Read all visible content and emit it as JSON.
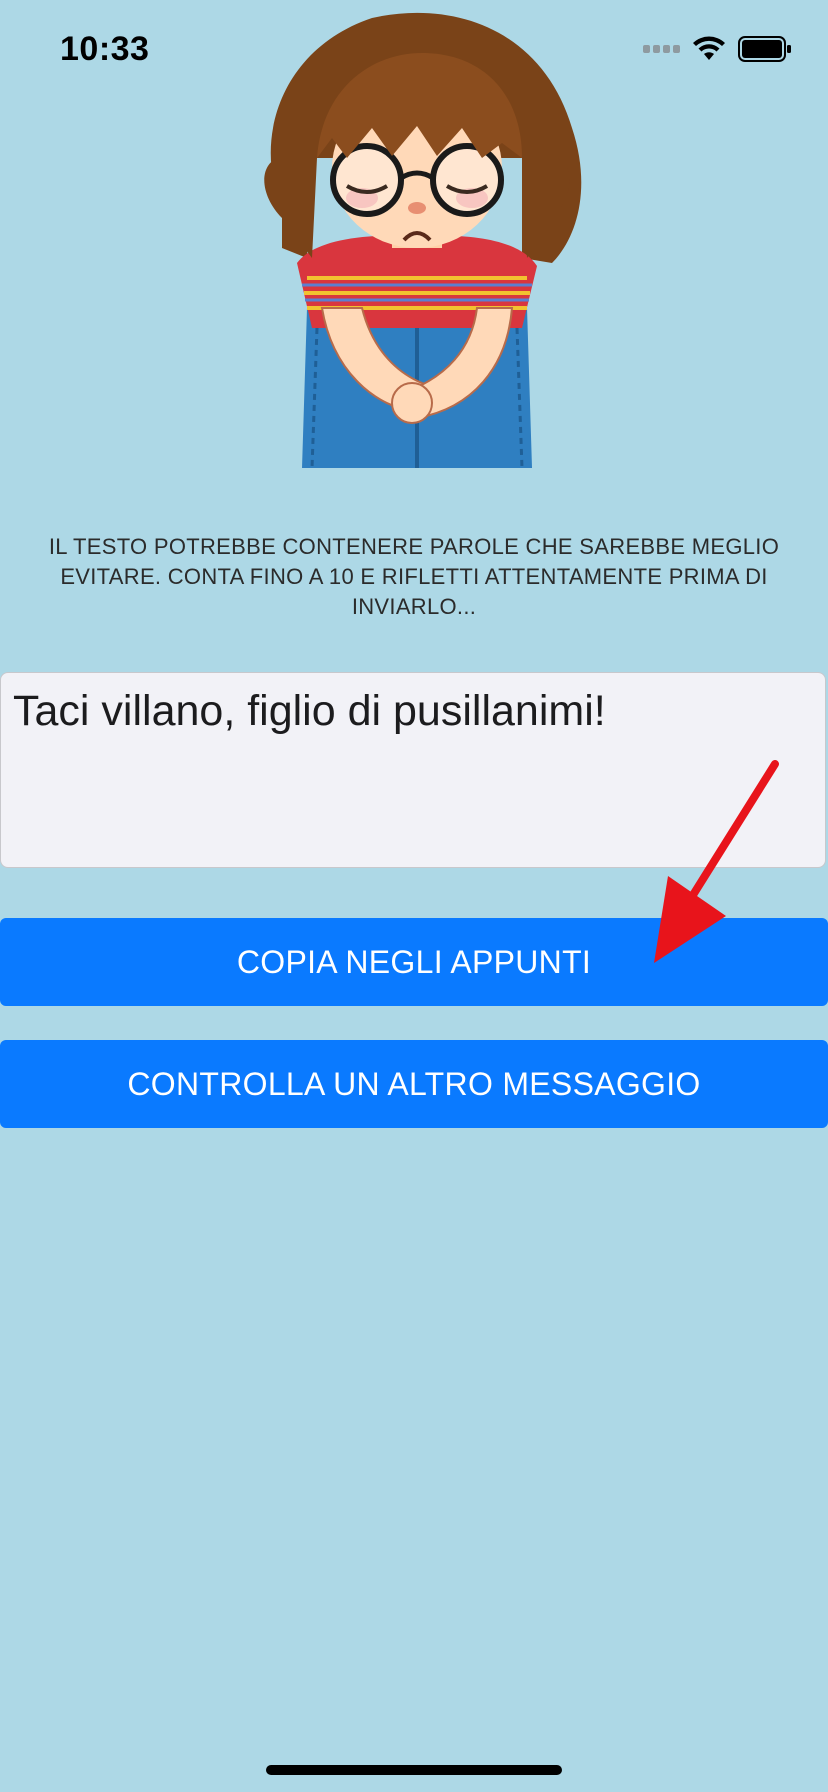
{
  "status_bar": {
    "time": "10:33"
  },
  "illustration": {
    "icon": "girl-sticker-illustration"
  },
  "warning": {
    "text": "IL TESTO POTREBBE CONTENERE PAROLE CHE SAREBBE MEGLIO EVITARE. CONTA FINO A 10 E RIFLETTI ATTENTAMENTE PRIMA DI INVIARLO..."
  },
  "message": {
    "value": "Taci villano, figlio di pusillanimi!"
  },
  "buttons": {
    "copy_label": "COPIA NEGLI APPUNTI",
    "check_label": "CONTROLLA UN ALTRO MESSAGGIO"
  },
  "colors": {
    "background": "#ADD8E6",
    "button": "#0A7AFF",
    "arrow": "#E8141B"
  }
}
